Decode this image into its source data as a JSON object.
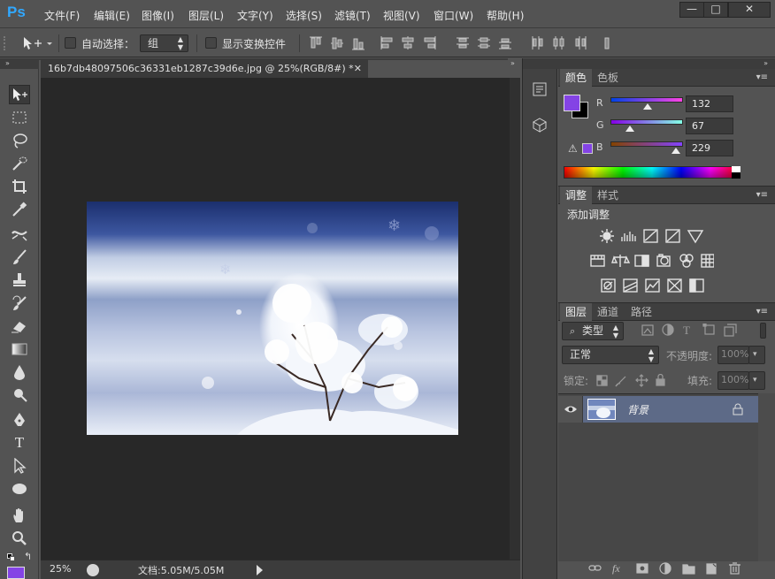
{
  "app": {
    "logo": "Ps"
  },
  "menu": [
    "文件(F)",
    "编辑(E)",
    "图像(I)",
    "图层(L)",
    "文字(Y)",
    "选择(S)",
    "滤镜(T)",
    "视图(V)",
    "窗口(W)",
    "帮助(H)"
  ],
  "window_controls": {
    "minimize": "—",
    "maximize": "□",
    "close": "✕"
  },
  "options": {
    "auto_select_label": "自动选择：",
    "auto_select_value": "组",
    "show_transform_label": "显示变换控件"
  },
  "document": {
    "tab_title": "16b7db48097506c36331eb1287c39d6e.jpg @ 25%(RGB/8#) *",
    "zoom": "25%",
    "doc_info": "文档:5.05M/5.05M"
  },
  "colors": {
    "foreground": "#8443e5",
    "background": "#000000"
  },
  "color_panel": {
    "tabs": [
      "颜色",
      "色板"
    ],
    "channels": [
      {
        "label": "R",
        "value": "132",
        "level": 0.518
      },
      {
        "label": "G",
        "value": "67",
        "level": 0.263
      },
      {
        "label": "B",
        "value": "229",
        "level": 0.898
      }
    ]
  },
  "adjustments_panel": {
    "tabs": [
      "调整",
      "样式"
    ],
    "heading": "添加调整"
  },
  "layers_panel": {
    "tabs": [
      "图层",
      "通道",
      "路径"
    ],
    "filter_label": "类型",
    "blend_mode": "正常",
    "opacity_label": "不透明度:",
    "opacity_value": "100%",
    "lock_label": "锁定:",
    "fill_label": "填充:",
    "fill_value": "100%",
    "layers": [
      {
        "name": "背景",
        "visible": true,
        "locked": true
      }
    ]
  },
  "icons": {
    "visibility": "eye-icon",
    "lock": "lock-icon",
    "panel_menu": "panel-menu-icon"
  }
}
